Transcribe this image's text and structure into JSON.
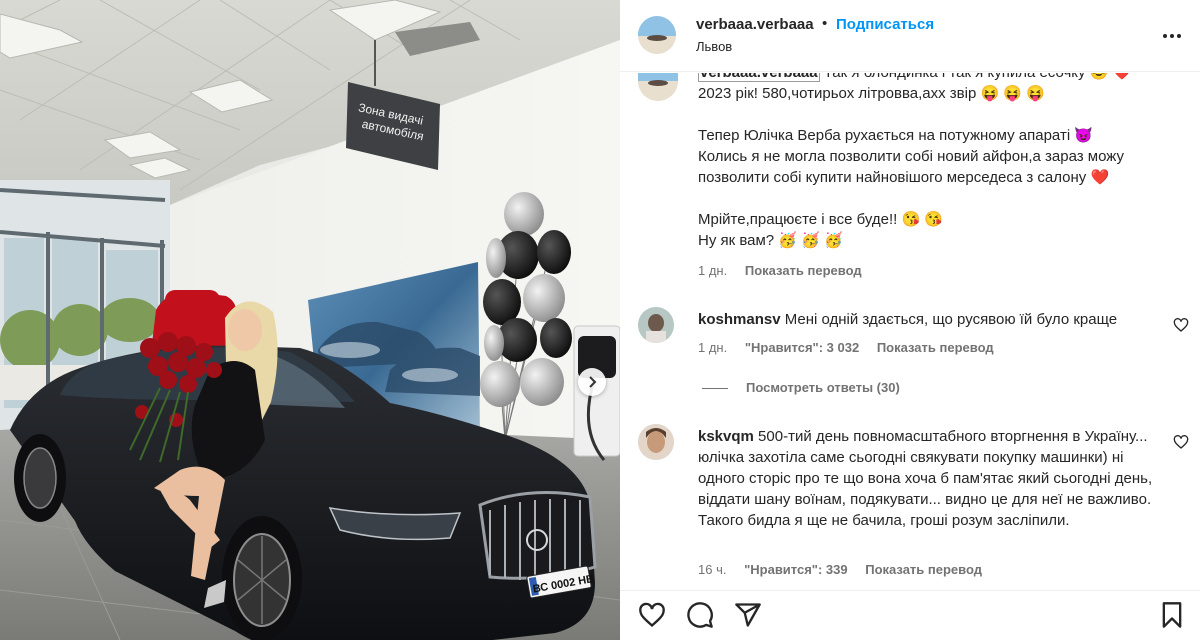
{
  "post": {
    "username": "verbaaa.verbaaa",
    "separator": "•",
    "follow_label": "Подписаться",
    "location": "Львов",
    "more_icon": "more-horizontal-icon"
  },
  "photo": {
    "sign_line1": "Зона видачі",
    "sign_line2": "автомобіля",
    "plate": "ВС 0002 НВ",
    "next_icon": "chevron-right-icon"
  },
  "caption": {
    "username": "verbaaa.verbaaa",
    "text": "Так я блондинка і так я купила есочку 😎 ❤️\n2023 рік! 580,чотирьох літровва,ахх звір 😝 😝 😝\n\nТепер Юлічка Верба рухається на потужному апараті 😈\nКолись я не могла позволити собі новий айфон,а зараз можу позволити собі купити найновішого мерседеса з салону ❤️\n\nМрійте,працюєте і все буде!! 😘 😘\nНу як вам? 🥳 🥳 🥳",
    "time": "1 дн.",
    "translate_label": "Показать перевод"
  },
  "comments": [
    {
      "username": "koshmansv",
      "text": "Мені одній здається, що русявою їй було краще",
      "time": "1 дн.",
      "likes": "\"Нравится\": 3 032",
      "translate_label": "Показать перевод",
      "replies_label": "Посмотреть ответы (30)"
    },
    {
      "username": "kskvqm",
      "text": "500-тий день повномасштабного вторгнення в Україну... юлічка захотіла саме сьогодні свякувати покупку машинки) ні одного сторіс про те що вона хоча б пам'ятає який сьогодні день, віддати шану воїнам, подякувати... видно це для неї не важливо. Такого бидла я ще не бачила, гроші розум засліпили.",
      "time": "16 ч.",
      "likes": "\"Нравится\": 339",
      "translate_label": "Показать перевод"
    }
  ],
  "actions": {
    "like_icon": "heart-icon",
    "comment_icon": "comment-icon",
    "share_icon": "send-icon",
    "save_icon": "bookmark-icon"
  }
}
